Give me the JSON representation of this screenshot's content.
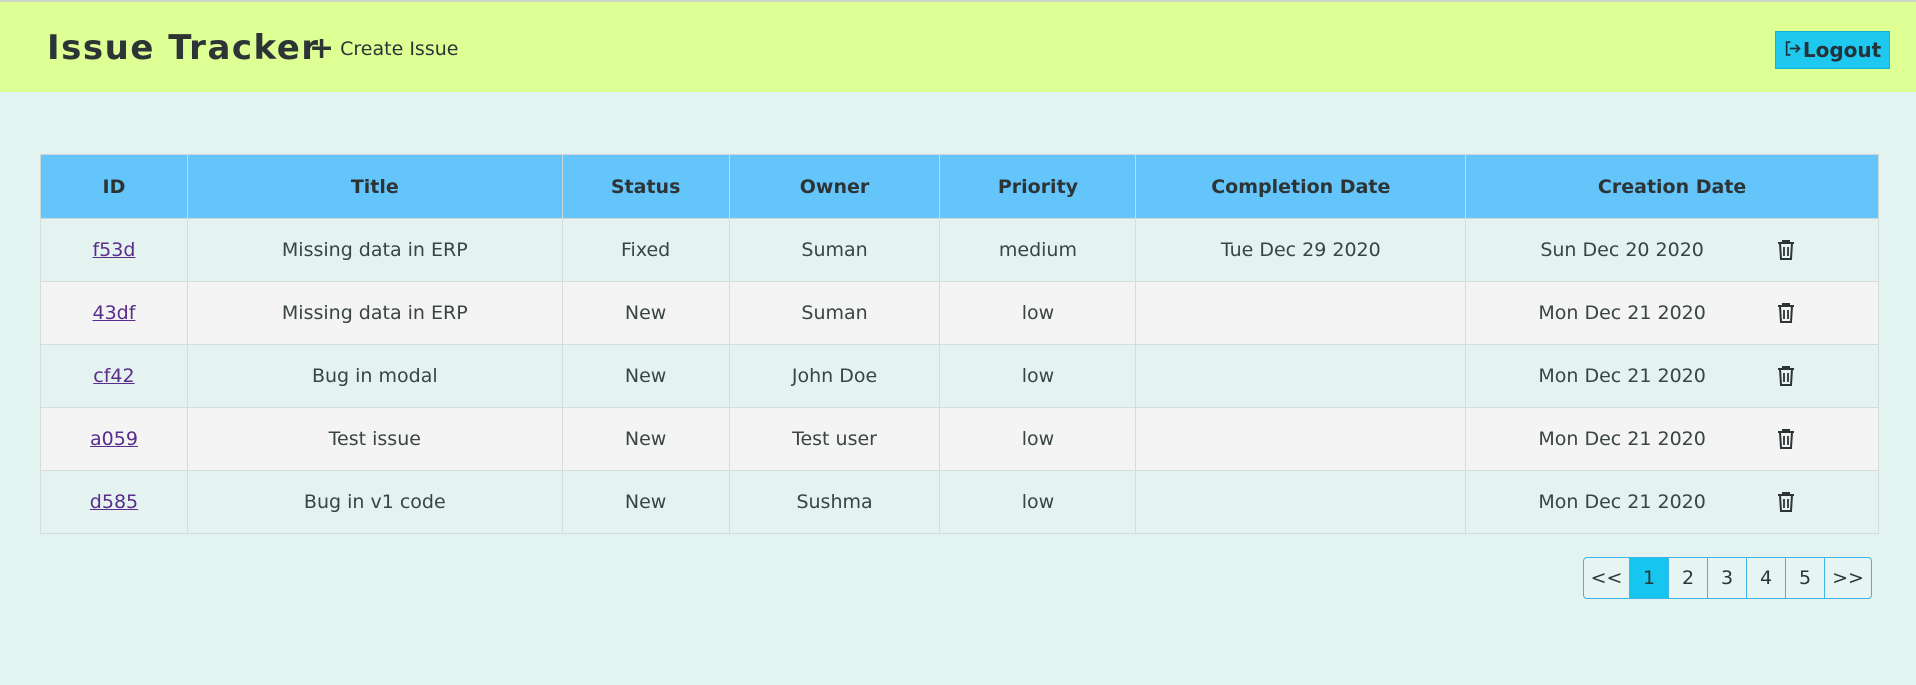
{
  "navbar": {
    "brand": "Issue Tracker",
    "create_label": "Create Issue",
    "logout_label": "Logout"
  },
  "table": {
    "headers": [
      "ID",
      "Title",
      "Status",
      "Owner",
      "Priority",
      "Completion Date",
      "Creation Date"
    ],
    "rows": [
      {
        "id": "f53d",
        "title": "Missing data in ERP",
        "status": "Fixed",
        "owner": "Suman",
        "priority": "medium",
        "completion": "Tue Dec 29 2020",
        "created": "Sun Dec 20 2020"
      },
      {
        "id": "43df",
        "title": "Missing data in ERP",
        "status": "New",
        "owner": "Suman",
        "priority": "low",
        "completion": "",
        "created": "Mon Dec 21 2020"
      },
      {
        "id": "cf42",
        "title": "Bug in modal",
        "status": "New",
        "owner": "John Doe",
        "priority": "low",
        "completion": "",
        "created": "Mon Dec 21 2020"
      },
      {
        "id": "a059",
        "title": "Test issue",
        "status": "New",
        "owner": "Test user",
        "priority": "low",
        "completion": "",
        "created": "Mon Dec 21 2020"
      },
      {
        "id": "d585",
        "title": "Bug in v1 code",
        "status": "New",
        "owner": "Sushma",
        "priority": "low",
        "completion": "",
        "created": "Mon Dec 21 2020"
      }
    ]
  },
  "pagination": {
    "prev": "<<",
    "pages": [
      "1",
      "2",
      "3",
      "4",
      "5"
    ],
    "active_page": "1",
    "next": ">>"
  },
  "icons": {
    "create": "plus-icon",
    "logout": "logout-icon",
    "delete": "trash-icon"
  },
  "colors": {
    "navbar_bg": "#ddff94",
    "page_bg": "#e3f3ef",
    "header_bg": "#64c5fa",
    "accent": "#17c6ee",
    "link": "#5a2c8c"
  }
}
